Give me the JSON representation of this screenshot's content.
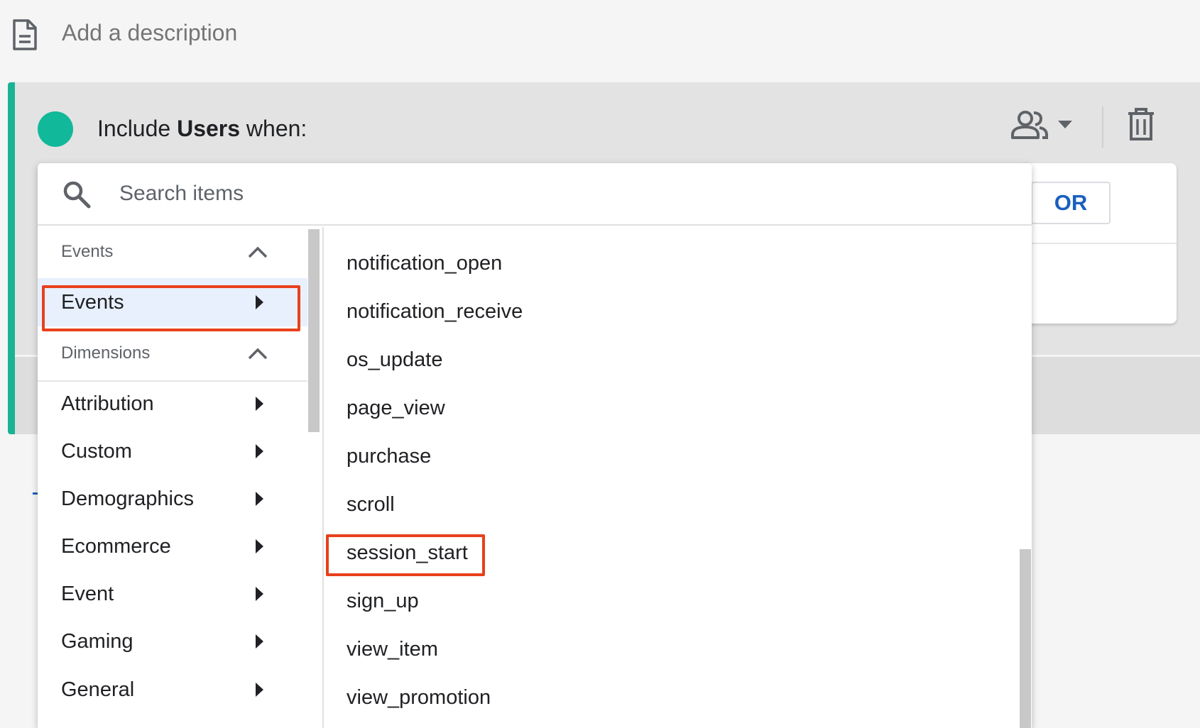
{
  "description": {
    "placeholder": "Add a description",
    "icon": "document-icon"
  },
  "condition": {
    "include_prefix": "Include",
    "include_entity": "Users",
    "include_suffix": "when:",
    "accent_color": "#12b89a",
    "scope_icon": "people-icon",
    "delete_icon": "trash-icon",
    "or_label": "OR"
  },
  "search": {
    "placeholder": "Search items",
    "icon": "search-icon"
  },
  "categories": {
    "events_group": "Events",
    "events_item": "Events",
    "dimensions_group": "Dimensions",
    "dimension_items": [
      "Attribution",
      "Custom",
      "Demographics",
      "Ecommerce",
      "Event",
      "Gaming",
      "General"
    ]
  },
  "events": [
    "notification_open",
    "notification_receive",
    "os_update",
    "page_view",
    "purchase",
    "scroll",
    "session_start",
    "sign_up",
    "view_item",
    "view_promotion"
  ],
  "highlight_color": "#e8401c"
}
